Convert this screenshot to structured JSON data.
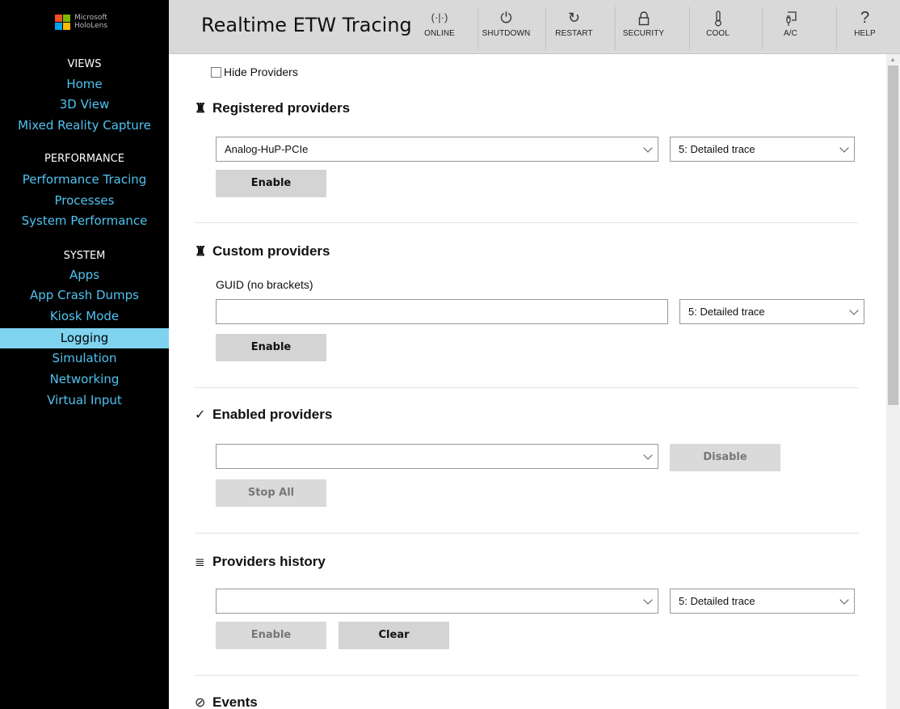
{
  "brand": {
    "line1": "Microsoft",
    "line2": "HoloLens",
    "colors": [
      "#f25022",
      "#7fba00",
      "#00a4ef",
      "#ffb900"
    ]
  },
  "sidebar": {
    "sections": [
      {
        "title": "VIEWS",
        "items": [
          "Home",
          "3D View",
          "Mixed Reality Capture"
        ]
      },
      {
        "title": "PERFORMANCE",
        "items": [
          "Performance Tracing",
          "Processes",
          "System Performance"
        ]
      },
      {
        "title": "SYSTEM",
        "items": [
          "Apps",
          "App Crash Dumps",
          "Kiosk Mode",
          "Logging",
          "Simulation",
          "Networking",
          "Virtual Input"
        ]
      }
    ],
    "active_item": "Logging",
    "link_color": "#4fc3f0",
    "active_bg": "#7fd3ef"
  },
  "header": {
    "title": "Realtime ETW Tracing",
    "buttons": [
      {
        "label": "ONLINE",
        "icon": "online-icon"
      },
      {
        "label": "SHUTDOWN",
        "icon": "power-icon"
      },
      {
        "label": "RESTART",
        "icon": "restart-icon"
      },
      {
        "label": "SECURITY",
        "icon": "lock-icon"
      },
      {
        "label": "COOL",
        "icon": "thermometer-icon"
      },
      {
        "label": "A/C",
        "icon": "plug-icon"
      },
      {
        "label": "HELP",
        "icon": "help-icon"
      }
    ]
  },
  "content": {
    "hide_providers": {
      "label": "Hide Providers",
      "checked": false
    },
    "registered": {
      "title": "Registered providers",
      "provider_value": "Analog-HuP-PCIe",
      "level_value": "5: Detailed trace",
      "enable_label": "Enable"
    },
    "custom": {
      "title": "Custom providers",
      "guid_label": "GUID (no brackets)",
      "guid_value": "",
      "level_value": "5: Detailed trace",
      "enable_label": "Enable"
    },
    "enabled": {
      "title": "Enabled providers",
      "provider_value": "",
      "disable_label": "Disable",
      "stop_all_label": "Stop All"
    },
    "history": {
      "title": "Providers history",
      "provider_value": "",
      "level_value": "5: Detailed trace",
      "enable_label": "Enable",
      "clear_label": "Clear"
    },
    "events": {
      "title": "Events"
    }
  }
}
